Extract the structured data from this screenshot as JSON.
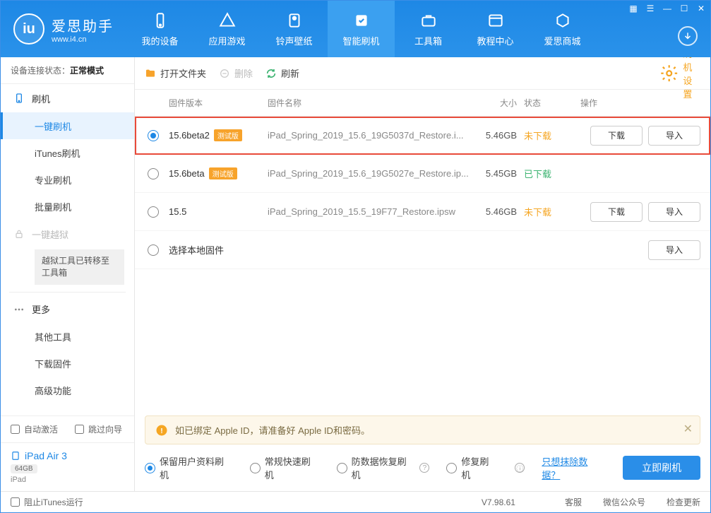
{
  "logo": {
    "cn": "爱思助手",
    "en": "www.i4.cn",
    "mark": "iu"
  },
  "nav": [
    {
      "label": "我的设备"
    },
    {
      "label": "应用游戏"
    },
    {
      "label": "铃声壁纸"
    },
    {
      "label": "智能刷机"
    },
    {
      "label": "工具箱"
    },
    {
      "label": "教程中心"
    },
    {
      "label": "爱思商城"
    }
  ],
  "conn": {
    "prefix": "设备连接状态：",
    "mode": "正常模式"
  },
  "sidebar": {
    "flash": {
      "title": "刷机",
      "subs": [
        "一键刷机",
        "iTunes刷机",
        "专业刷机",
        "批量刷机"
      ]
    },
    "jailbreak": {
      "title": "一键越狱",
      "note": "越狱工具已转移至工具箱"
    },
    "more": {
      "title": "更多",
      "subs": [
        "其他工具",
        "下载固件",
        "高级功能"
      ]
    }
  },
  "checks": {
    "autoActivate": "自动激活",
    "skipGuide": "跳过向导"
  },
  "device": {
    "name": "iPad Air 3",
    "storage": "64GB",
    "model": "iPad"
  },
  "toolbar": {
    "openFolder": "打开文件夹",
    "delete": "删除",
    "refresh": "刷新",
    "settings": "刷机设置"
  },
  "columns": {
    "ver": "固件版本",
    "name": "固件名称",
    "size": "大小",
    "status": "状态",
    "ops": "操作"
  },
  "btns": {
    "download": "下载",
    "import": "导入"
  },
  "rows": [
    {
      "selected": true,
      "highlighted": true,
      "ver": "15.6beta2",
      "beta": true,
      "betaLabel": "测试版",
      "name": "iPad_Spring_2019_15.6_19G5037d_Restore.i...",
      "size": "5.46GB",
      "status": "未下载",
      "statusClass": "st-orange",
      "showDownload": true,
      "showImport": true
    },
    {
      "selected": false,
      "highlighted": false,
      "ver": "15.6beta",
      "beta": true,
      "betaLabel": "测试版",
      "name": "iPad_Spring_2019_15.6_19G5027e_Restore.ip...",
      "size": "5.45GB",
      "status": "已下载",
      "statusClass": "st-green",
      "showDownload": false,
      "showImport": false
    },
    {
      "selected": false,
      "highlighted": false,
      "ver": "15.5",
      "beta": false,
      "name": "iPad_Spring_2019_15.5_19F77_Restore.ipsw",
      "size": "5.46GB",
      "status": "未下载",
      "statusClass": "st-orange",
      "showDownload": true,
      "showImport": true
    }
  ],
  "localRow": {
    "label": "选择本地固件",
    "import": "导入"
  },
  "alert": "如已绑定 Apple ID，请准备好 Apple ID和密码。",
  "options": {
    "items": [
      "保留用户资料刷机",
      "常规快速刷机",
      "防数据恢复刷机",
      "修复刷机"
    ],
    "wipeLink": "只想抹除数据？",
    "action": "立即刷机"
  },
  "statusbar": {
    "blockItunes": "阻止iTunes运行",
    "version": "V7.98.61",
    "links": [
      "客服",
      "微信公众号",
      "检查更新"
    ]
  }
}
